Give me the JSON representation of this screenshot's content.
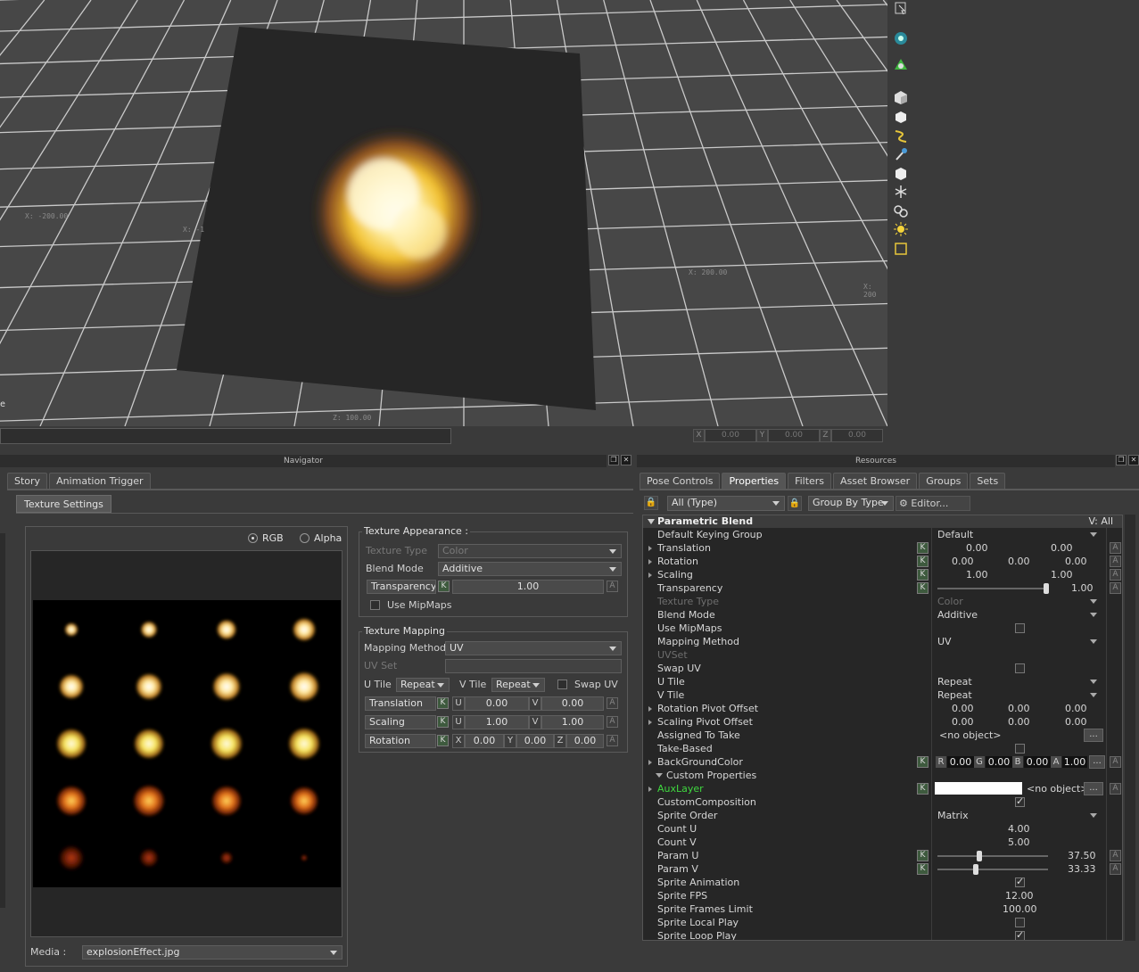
{
  "viewport": {
    "axis_labels": [
      "X: -200.00",
      "X: -1",
      "X: 200.00",
      "X: 200",
      "Z: 100.00"
    ],
    "corner_text": "e",
    "coords": [
      {
        "label": "X",
        "value": "0.00"
      },
      {
        "label": "Y",
        "value": "0.00"
      },
      {
        "label": "Z",
        "value": "0.00"
      }
    ]
  },
  "tools": [
    "select-icon",
    "camera-icon",
    "marker-icon",
    "cube-icon",
    "cube-small-icon",
    "path-icon",
    "needle-icon",
    "hexagon-icon",
    "axis-icon",
    "character-icon",
    "light-icon",
    "rect-icon"
  ],
  "navigator": {
    "title": "Navigator",
    "tabs": [
      "Story",
      "Animation Trigger"
    ],
    "sub_tab": "Texture Settings",
    "radio_rgb": "RGB",
    "radio_alpha": "Alpha",
    "media_label": "Media :",
    "media_value": "explosionEffect.jpg",
    "appearance": {
      "title": "Texture Appearance :",
      "texture_type_label": "Texture Type",
      "texture_type_value": "Color",
      "blend_mode_label": "Blend Mode",
      "blend_mode_value": "Additive",
      "transparency_label": "Transparency",
      "transparency_value": "1.00",
      "mipmaps_label": "Use MipMaps"
    },
    "mapping": {
      "title": "Texture Mapping",
      "method_label": "Mapping Method",
      "method_value": "UV",
      "uvset_label": "UV Set",
      "utile_label": "U Tile",
      "utile_value": "Repeat",
      "vtile_label": "V Tile",
      "vtile_value": "Repeat",
      "swapuv_label": "Swap UV",
      "translation_label": "Translation",
      "translation_u": "0.00",
      "translation_v": "0.00",
      "scaling_label": "Scaling",
      "scaling_u": "1.00",
      "scaling_v": "1.00",
      "rotation_label": "Rotation",
      "rotation_x": "0.00",
      "rotation_y": "0.00",
      "rotation_z": "0.00"
    }
  },
  "resources": {
    "title": "Resources",
    "tabs": [
      "Pose Controls",
      "Properties",
      "Filters",
      "Asset Browser",
      "Groups",
      "Sets"
    ],
    "filter_value": "All (Type)",
    "group_value": "Group By Type",
    "editor_label": "Editor...",
    "header_title": "Parametric Blend",
    "header_right": "V: All",
    "rows": {
      "default_keying": {
        "label": "Default Keying Group",
        "value": "Default"
      },
      "translation": {
        "label": "Translation",
        "v1": "0.00",
        "v2": "0.00"
      },
      "rotation": {
        "label": "Rotation",
        "v1": "0.00",
        "v2": "0.00",
        "v3": "0.00"
      },
      "scaling": {
        "label": "Scaling",
        "v1": "1.00",
        "v2": "1.00"
      },
      "transparency": {
        "label": "Transparency",
        "value": "1.00"
      },
      "texture_type": {
        "label": "Texture Type",
        "value": "Color"
      },
      "blend_mode": {
        "label": "Blend Mode",
        "value": "Additive"
      },
      "use_mipmaps": {
        "label": "Use MipMaps"
      },
      "mapping_method": {
        "label": "Mapping Method",
        "value": "UV"
      },
      "uvset": {
        "label": "UVSet"
      },
      "swap_uv": {
        "label": "Swap UV"
      },
      "u_tile": {
        "label": "U Tile",
        "value": "Repeat"
      },
      "v_tile": {
        "label": "V Tile",
        "value": "Repeat"
      },
      "rot_pivot": {
        "label": "Rotation Pivot Offset",
        "v1": "0.00",
        "v2": "0.00",
        "v3": "0.00"
      },
      "scale_pivot": {
        "label": "Scaling Pivot Offset",
        "v1": "0.00",
        "v2": "0.00",
        "v3": "0.00"
      },
      "assigned_take": {
        "label": "Assigned To Take",
        "value": "<no object>"
      },
      "take_based": {
        "label": "Take-Based"
      },
      "bg_color": {
        "label": "BackGroundColor",
        "r": "0.00",
        "g": "0.00",
        "b": "0.00",
        "a": "1.00"
      },
      "custom_props": {
        "label": "Custom Properties"
      },
      "aux_layer": {
        "label": "AuxLayer",
        "value": "<no object>"
      },
      "custom_comp": {
        "label": "CustomComposition"
      },
      "sprite_order": {
        "label": "Sprite Order",
        "value": "Matrix"
      },
      "count_u": {
        "label": "Count U",
        "value": "4.00"
      },
      "count_v": {
        "label": "Count V",
        "value": "5.00"
      },
      "param_u": {
        "label": "Param U",
        "value": "37.50"
      },
      "param_v": {
        "label": "Param V",
        "value": "33.33"
      },
      "sprite_anim": {
        "label": "Sprite Animation"
      },
      "sprite_fps": {
        "label": "Sprite FPS",
        "value": "12.00"
      },
      "sprite_frames": {
        "label": "Sprite Frames Limit",
        "value": "100.00"
      },
      "sprite_local": {
        "label": "Sprite Local Play"
      },
      "sprite_loop": {
        "label": "Sprite Loop Play"
      }
    },
    "rgba_labels": [
      "R",
      "G",
      "B",
      "A"
    ],
    "k_label": "K",
    "a_label": "A",
    "ellipsis": "..."
  },
  "colors": {
    "accent_green": "#3fd83f",
    "fire_core": "#fff6c8",
    "fire_mid": "#f2c12e",
    "fire_outer": "#c4571a"
  }
}
